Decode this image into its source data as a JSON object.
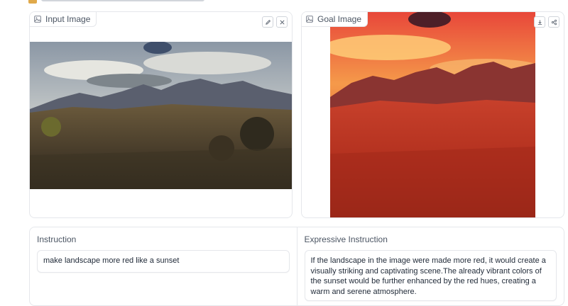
{
  "input_panel": {
    "label": "Input Image",
    "icons": [
      "image-icon",
      "edit-icon",
      "close-icon"
    ]
  },
  "goal_panel": {
    "label": "Goal Image",
    "icons": [
      "image-icon",
      "download-icon",
      "share-icon"
    ]
  },
  "instruction": {
    "label": "Instruction",
    "value": "make landscape more red like a sunset"
  },
  "expressive_instruction": {
    "label": "Expressive Instruction",
    "value": "If the landscape in the image were made more red, it would create a visually striking and captivating scene.The already vibrant colors of the sunset would be further enhanced by the red hues, creating a warm and serene atmosphere."
  }
}
